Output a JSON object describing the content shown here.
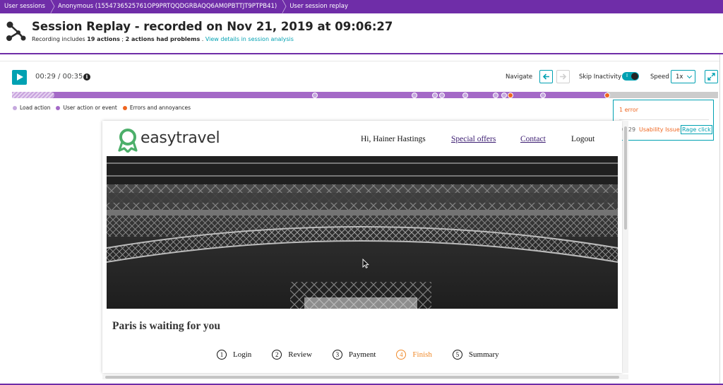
{
  "breadcrumb": [
    {
      "label": "User sessions"
    },
    {
      "label": "Anonymous (1554736525761OP9PRTQQDGRBAQQ6AM0PBTTJT9PTPB41)"
    },
    {
      "label": "User session replay"
    }
  ],
  "header": {
    "title": "Session Replay - recorded on Nov 21, 2019 at 09:06:27",
    "sub_prefix": "Recording includes",
    "actions": "19 actions",
    "sep": ";",
    "problems": "2 actions had problems",
    "dot": ".",
    "details_link": "View details in session analysis",
    "icon": "share-nodes-icon"
  },
  "player": {
    "current_time": "00:29",
    "divider": "/",
    "total_time": "00:35",
    "progress_fraction": 0.843,
    "info_icon": "info-icon",
    "navigate_label": "Navigate",
    "skip_label": "Skip Inactivity",
    "skip_on": true,
    "toggle_mark": "I",
    "speed_label": "Speed",
    "speed_value": "1x"
  },
  "timeline": {
    "loaded_fraction": 0.06,
    "events": [
      {
        "t": 0.429,
        "type": "action"
      },
      {
        "t": 0.57,
        "type": "action"
      },
      {
        "t": 0.599,
        "type": "action"
      },
      {
        "t": 0.609,
        "type": "action"
      },
      {
        "t": 0.642,
        "type": "action"
      },
      {
        "t": 0.685,
        "type": "action"
      },
      {
        "t": 0.697,
        "type": "action"
      },
      {
        "t": 0.706,
        "type": "error"
      },
      {
        "t": 0.752,
        "type": "action"
      },
      {
        "t": 0.843,
        "type": "error"
      }
    ]
  },
  "legend": [
    {
      "label": "Load action",
      "color": "#c5a8de"
    },
    {
      "label": "User action or event",
      "color": "#a469c7"
    },
    {
      "label": "Errors and annoyances",
      "color": "#ef651f"
    }
  ],
  "popup": {
    "count": "1 error",
    "time": "00:29",
    "type": "Usability Issue:",
    "link": "Rage click"
  },
  "site": {
    "brand": "easytravel",
    "greeting": "Hi, Hainer Hastings",
    "special_offers": "Special offers",
    "contact": "Contact",
    "logout": "Logout",
    "headline": "Paris is waiting for you",
    "steps": [
      {
        "num": "1",
        "label": "Login"
      },
      {
        "num": "2",
        "label": "Review"
      },
      {
        "num": "3",
        "label": "Payment"
      },
      {
        "num": "4",
        "label": "Finish",
        "active": true
      },
      {
        "num": "5",
        "label": "Summary"
      }
    ]
  },
  "colors": {
    "brand_purple": "#6f2da8",
    "accent_teal": "#00a1b2",
    "error_orange": "#ef651f",
    "step_active": "#f08a2a"
  }
}
